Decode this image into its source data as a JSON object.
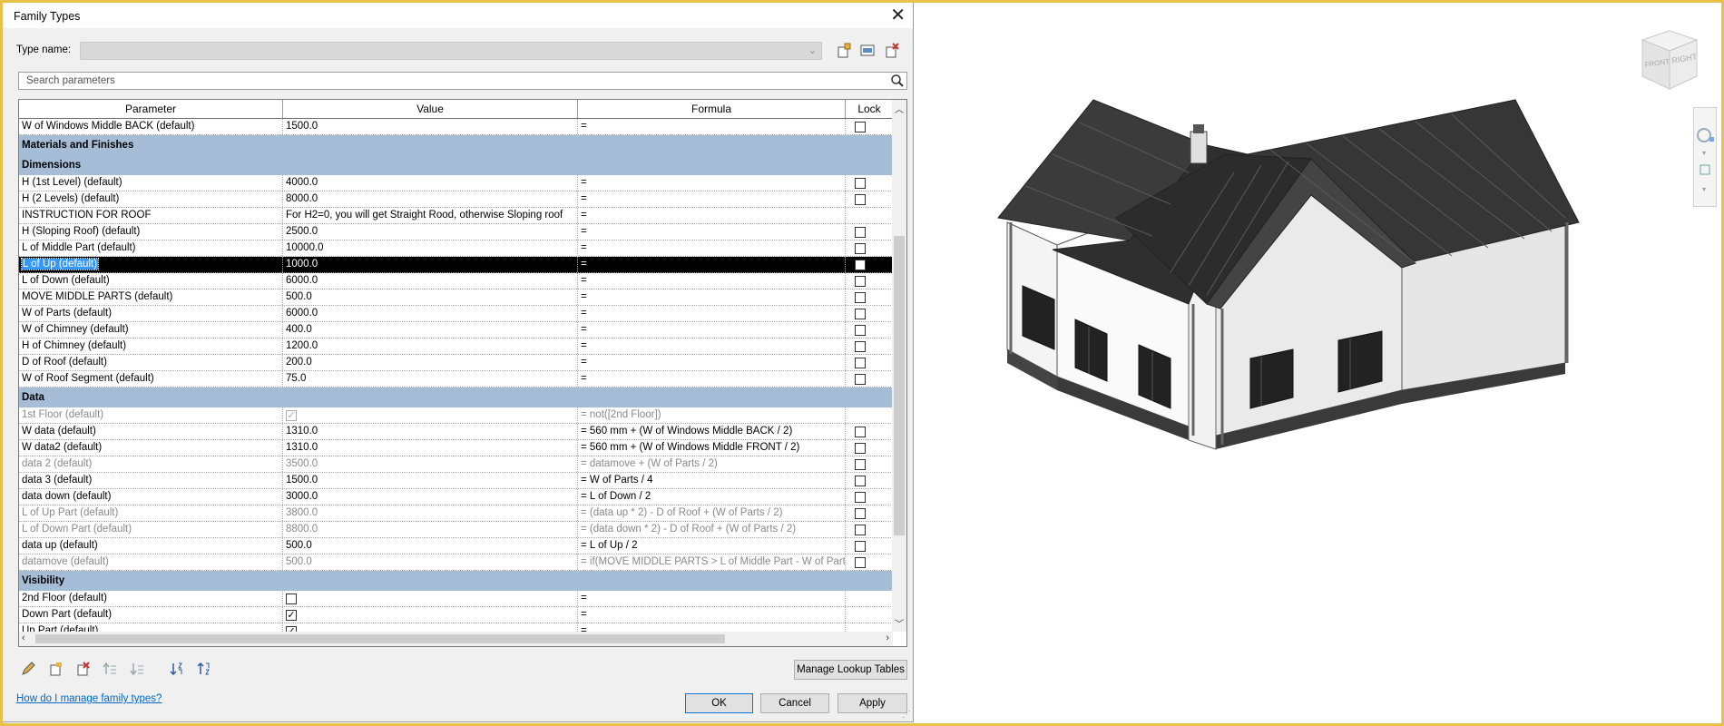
{
  "dialog": {
    "title": "Family Types",
    "type_name_label": "Type name:",
    "type_name_value": "",
    "search_placeholder": "Search parameters",
    "columns": [
      "Parameter",
      "Value",
      "Formula",
      "Lock"
    ],
    "rows": [
      {
        "param": "W of Windows Middle BACK (default)",
        "value": "1500.0",
        "formula": "=",
        "lock": "unchecked"
      },
      {
        "group": "Materials and Finishes"
      },
      {
        "group": "Dimensions"
      },
      {
        "param": "H (1st Level) (default)",
        "value": "4000.0",
        "formula": "=",
        "lock": "unchecked"
      },
      {
        "param": "H (2 Levels) (default)",
        "value": "8000.0",
        "formula": "=",
        "lock": "unchecked"
      },
      {
        "param": "INSTRUCTION FOR ROOF",
        "value": "For H2=0, you will get Straight Rood, otherwise Sloping roof",
        "formula": "=",
        "lock": "none"
      },
      {
        "param": "H (Sloping Roof) (default)",
        "value": "2500.0",
        "formula": "=",
        "lock": "unchecked"
      },
      {
        "param": "L of Middle Part (default)",
        "value": "10000.0",
        "formula": "=",
        "lock": "unchecked"
      },
      {
        "param": "L of Up (default)",
        "value": "1000.0",
        "formula": "=",
        "lock": "unchecked",
        "selected": true
      },
      {
        "param": "L of Down (default)",
        "value": "6000.0",
        "formula": "=",
        "lock": "unchecked"
      },
      {
        "param": "MOVE MIDDLE PARTS (default)",
        "value": "500.0",
        "formula": "=",
        "lock": "unchecked"
      },
      {
        "param": "W of Parts (default)",
        "value": "6000.0",
        "formula": "=",
        "lock": "unchecked"
      },
      {
        "param": "W of Chimney (default)",
        "value": "400.0",
        "formula": "=",
        "lock": "unchecked"
      },
      {
        "param": "H of Chimney (default)",
        "value": "1200.0",
        "formula": "=",
        "lock": "unchecked"
      },
      {
        "param": "D of Roof (default)",
        "value": "200.0",
        "formula": "=",
        "lock": "unchecked"
      },
      {
        "param": "W of Roof Segment (default)",
        "value": "75.0",
        "formula": "=",
        "lock": "unchecked"
      },
      {
        "group": "Data"
      },
      {
        "param": "1st Floor (default)",
        "value_checkbox": "checked-grey",
        "formula": "= not([2nd Floor])",
        "lock": "none",
        "greyed": true
      },
      {
        "param": "W data (default)",
        "value": "1310.0",
        "formula": "= 560 mm + (W of Windows Middle BACK / 2)",
        "lock": "unchecked"
      },
      {
        "param": "W data2 (default)",
        "value": "1310.0",
        "formula": "= 560 mm + (W of Windows Middle FRONT / 2)",
        "lock": "unchecked"
      },
      {
        "param": "data 2 (default)",
        "value": "3500.0",
        "formula": "= datamove + (W of Parts / 2)",
        "lock": "unchecked",
        "greyed": true
      },
      {
        "param": "data 3 (default)",
        "value": "1500.0",
        "formula": "= W of Parts / 4",
        "lock": "unchecked"
      },
      {
        "param": "data down (default)",
        "value": "3000.0",
        "formula": "= L of Down / 2",
        "lock": "unchecked"
      },
      {
        "param": "L of Up Part (default)",
        "value": "3800.0",
        "formula": "= (data up * 2) - D of Roof + (W of Parts / 2)",
        "lock": "unchecked",
        "greyed": true
      },
      {
        "param": "L of Down Part (default)",
        "value": "8800.0",
        "formula": "= (data down * 2) - D of Roof + (W of Parts / 2)",
        "lock": "unchecked",
        "greyed": true
      },
      {
        "param": "data up (default)",
        "value": "500.0",
        "formula": "= L of Up / 2",
        "lock": "unchecked"
      },
      {
        "param": "datamove (default)",
        "value": "500.0",
        "formula": "= if(MOVE MIDDLE PARTS > L of Middle Part - W of Part",
        "lock": "unchecked",
        "greyed": true
      },
      {
        "group": "Visibility"
      },
      {
        "param": "2nd Floor (default)",
        "value_checkbox": "unchecked",
        "formula": "=",
        "lock": "none"
      },
      {
        "param": "Down Part (default)",
        "value_checkbox": "checked",
        "formula": "=",
        "lock": "none"
      },
      {
        "param": "Up Part (default)",
        "value_checkbox": "checked",
        "formula": "=",
        "lock": "none"
      }
    ],
    "manage_lookup_label": "Manage Lookup Tables",
    "help_link": "How do I manage family types?",
    "ok_label": "OK",
    "cancel_label": "Cancel",
    "apply_label": "Apply"
  },
  "viewcube": {
    "front_label": "FRONT",
    "right_label": "RIGHT"
  },
  "colors": {
    "group_header": "#a5bdd7",
    "frame_border": "#e8c14a",
    "link": "#0066cc",
    "selection": "#000000"
  }
}
